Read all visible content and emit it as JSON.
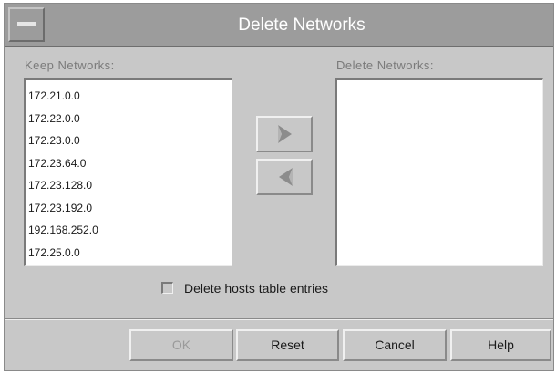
{
  "window": {
    "title": "Delete Networks"
  },
  "keep_networks": {
    "label": "Keep Networks:",
    "items": [
      "172.21.0.0",
      "172.22.0.0",
      "172.23.0.0",
      "172.23.64.0",
      "172.23.128.0",
      "172.23.192.0",
      "192.168.252.0",
      "172.25.0.0"
    ]
  },
  "delete_networks": {
    "label": "Delete Networks:",
    "items": []
  },
  "move_buttons": {
    "move_right_icon": "right-arrow-icon",
    "move_left_icon": "left-arrow-icon"
  },
  "options": {
    "delete_hosts_label": "Delete hosts table entries",
    "delete_hosts_checked": false
  },
  "buttons": {
    "ok": "OK",
    "ok_enabled": false,
    "reset": "Reset",
    "cancel": "Cancel",
    "help": "Help"
  },
  "colors": {
    "dialog_background": "#c8c8c8",
    "titlebar_background": "#9c9c9c",
    "title_text": "#ffffff",
    "list_background": "#ffffff",
    "disabled_text": "#9a9a9a",
    "column_label_text": "#7a7a7a"
  }
}
